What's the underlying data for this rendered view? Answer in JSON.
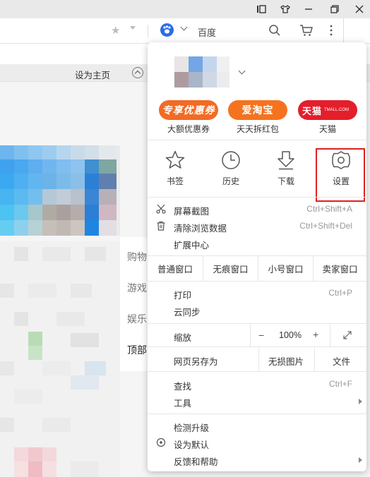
{
  "address_bar": {
    "search_engine": "百度"
  },
  "page": {
    "set_homepage": "设为主页",
    "nav_items": [
      "购物",
      "游戏",
      "娱乐",
      "顶部"
    ]
  },
  "menu": {
    "promos": [
      {
        "title": "专享优惠券",
        "label": "大额优惠券",
        "color": "#f36b24"
      },
      {
        "title": "爱淘宝",
        "label": "天天拆红包",
        "color": "#f5731f"
      },
      {
        "title": "天猫",
        "badge": "TMALL.COM",
        "label": "天猫",
        "color": "#e41e2b"
      }
    ],
    "tools": [
      {
        "label": "书签",
        "icon": "star-outline-icon"
      },
      {
        "label": "历史",
        "icon": "clock-icon"
      },
      {
        "label": "下载",
        "icon": "download-icon"
      },
      {
        "label": "设置",
        "icon": "gear-icon"
      }
    ],
    "group1": [
      {
        "label": "屏幕截图",
        "shortcut": "Ctrl+Shift+A",
        "icon": "scissors-icon"
      },
      {
        "label": "清除浏览数据",
        "shortcut": "Ctrl+Shift+Del",
        "icon": "trash-icon"
      },
      {
        "label": "扩展中心",
        "shortcut": ""
      }
    ],
    "windows": [
      "普通窗口",
      "无痕窗口",
      "小号窗口",
      "卖家窗口"
    ],
    "group2": [
      {
        "label": "打印",
        "shortcut": "Ctrl+P"
      },
      {
        "label": "云同步",
        "shortcut": ""
      }
    ],
    "zoom": {
      "label": "缩放",
      "minus": "−",
      "value": "100%",
      "plus": "+"
    },
    "save": {
      "label": "网页另存为",
      "lossless": "无损图片",
      "file": "文件"
    },
    "group3": [
      {
        "label": "查找",
        "shortcut": "Ctrl+F"
      },
      {
        "label": "工具",
        "shortcut": "",
        "submenu": true
      }
    ],
    "group4": [
      {
        "label": "检测升级"
      },
      {
        "label": "设为默认",
        "icon": "radio-circle-icon"
      },
      {
        "label": "反馈和帮助",
        "submenu": true
      }
    ]
  }
}
